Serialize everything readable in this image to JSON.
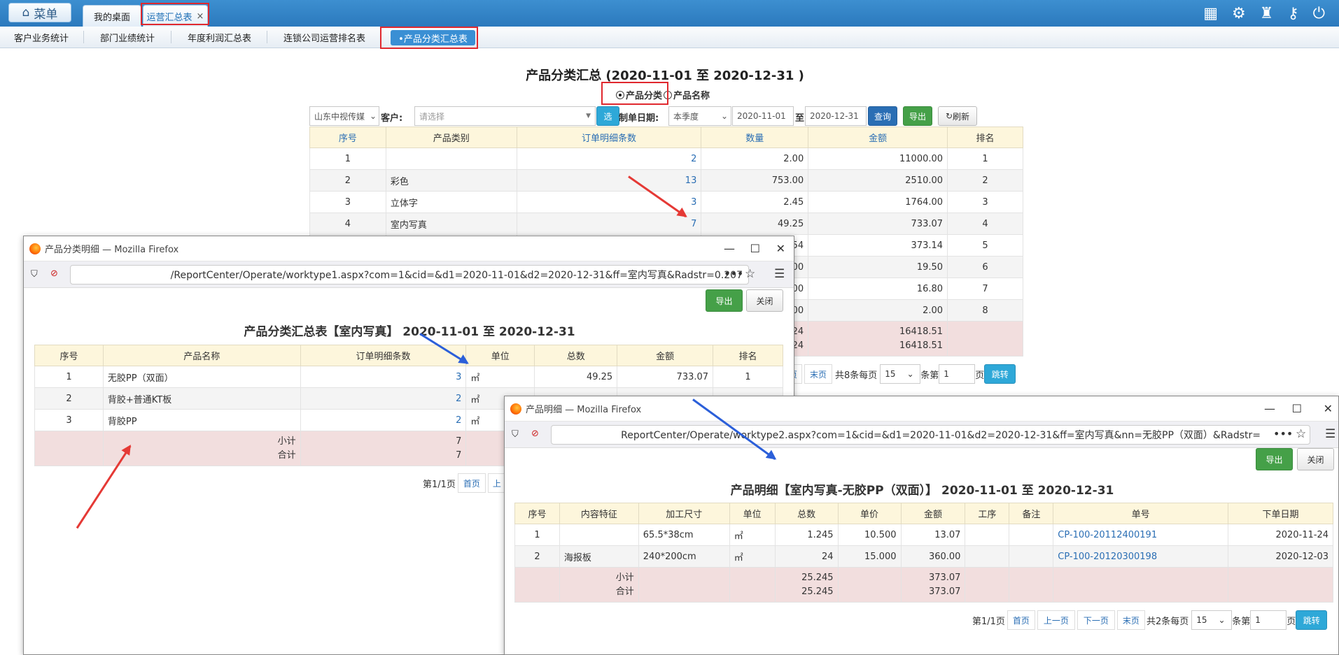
{
  "topbar": {
    "menu_label": "菜单",
    "tabs": [
      {
        "label": "我的桌面"
      },
      {
        "label": "运营汇总表",
        "close": "×"
      }
    ]
  },
  "subtabs": [
    "客户业务统计",
    "部门业绩统计",
    "年度利润汇总表",
    "连锁公司运营排名表",
    "•产品分类汇总表"
  ],
  "main": {
    "title": "产品分类汇总 (2020-11-01 至 2020-12-31 )",
    "radio1": "产品分类",
    "radio2": "产品名称",
    "company_select": "山东中视传媒",
    "customer_label": "客户:",
    "customer_placeholder": "请选择",
    "select_btn": "选",
    "date_label": "制单日期:",
    "period": "本季度",
    "date_from": "2020-11-01",
    "to_label": "至",
    "date_to": "2020-12-31",
    "query_btn": "查询",
    "export_btn": "导出",
    "refresh_btn": "刷新",
    "headers": [
      "序号",
      "产品类别",
      "订单明细条数",
      "数量",
      "金额",
      "排名"
    ],
    "rows": [
      [
        "1",
        "",
        "2",
        "2.00",
        "11000.00",
        "1"
      ],
      [
        "2",
        "彩色",
        "13",
        "753.00",
        "2510.00",
        "2"
      ],
      [
        "3",
        "立体字",
        "3",
        "2.45",
        "1764.00",
        "3"
      ],
      [
        "4",
        "室内写真",
        "7",
        "49.25",
        "733.07",
        "4"
      ],
      [
        "",
        "",
        "",
        ".54",
        "373.14",
        "5"
      ],
      [
        "",
        "",
        "",
        ".00",
        "19.50",
        "6"
      ],
      [
        "",
        "",
        "",
        ".00",
        "16.80",
        "7"
      ],
      [
        "",
        "",
        "",
        ".00",
        "2.00",
        "8"
      ]
    ],
    "sum_qty1": ".24",
    "sum_qty2": ".24",
    "sum_amt1": "16418.51",
    "sum_amt2": "16418.51",
    "pager": {
      "first_partial": "页",
      "last": "末页",
      "info": "共8条每页",
      "size": "15",
      "pre": "条第",
      "page": "1",
      "suf": "页",
      "jump": "跳转"
    }
  },
  "win1": {
    "title": "产品分类明细 — Mozilla Firefox",
    "url": "/ReportCenter/Operate/worktype1.aspx?com=1&cid=&d1=2020-11-01&d2=2020-12-31&ff=室内写真&Radstr=0.207",
    "export_btn": "导出",
    "close_btn": "关闭",
    "heading": "产品分类汇总表【室内写真】 2020-11-01 至 2020-12-31",
    "headers": [
      "序号",
      "产品名称",
      "订单明细条数",
      "单位",
      "总数",
      "金额",
      "排名"
    ],
    "rows": [
      [
        "1",
        "无胶PP（双面）",
        "3",
        "㎡",
        "49.25",
        "733.07",
        "1"
      ],
      [
        "2",
        "背胶+普通KT板",
        "2",
        "㎡",
        "",
        "",
        ""
      ],
      [
        "3",
        "背胶PP",
        "2",
        "㎡",
        "",
        "",
        ""
      ]
    ],
    "subtotal_label": "小计",
    "total_label": "合计",
    "subtotal": "7",
    "total": "7",
    "pager": {
      "info": "第1/1页",
      "first": "首页",
      "prev_partial": "上"
    }
  },
  "win2": {
    "title": "产品明细 — Mozilla Firefox",
    "url": "ReportCenter/Operate/worktype2.aspx?com=1&cid=&d1=2020-11-01&d2=2020-12-31&ff=室内写真&nn=无胶PP（双面）&Radstr=",
    "export_btn": "导出",
    "close_btn": "关闭",
    "heading": "产品明细【室内写真-无胶PP（双面）】 2020-11-01 至 2020-12-31",
    "headers": [
      "序号",
      "内容特征",
      "加工尺寸",
      "单位",
      "总数",
      "单价",
      "金额",
      "工序",
      "备注",
      "单号",
      "下单日期"
    ],
    "rows": [
      [
        "1",
        "",
        "65.5*38cm",
        "㎡",
        "1.245",
        "10.500",
        "13.07",
        "",
        "",
        "CP-100-20112400191",
        "2020-11-24"
      ],
      [
        "2",
        "海报板",
        "240*200cm",
        "㎡",
        "24",
        "15.000",
        "360.00",
        "",
        "",
        "CP-100-20120300198",
        "2020-12-03"
      ]
    ],
    "subtotal_label": "小计",
    "total_label": "合计",
    "sub_qty": "25.245",
    "tot_qty": "25.245",
    "sub_amt": "373.07",
    "tot_amt": "373.07",
    "pager": {
      "info": "第1/1页",
      "first": "首页",
      "prev": "上一页",
      "next": "下一页",
      "last": "末页",
      "count": "共2条每页",
      "size": "15",
      "pre": "条第",
      "page": "1",
      "suf": "页",
      "jump": "跳转"
    }
  },
  "colors": {
    "accent": "#2a6eb4",
    "highlight_red": "#e0282e",
    "arrow_blue": "#2b5fd9",
    "header_bg": "#fdf6dc",
    "sum_bg": "#f2dede"
  }
}
